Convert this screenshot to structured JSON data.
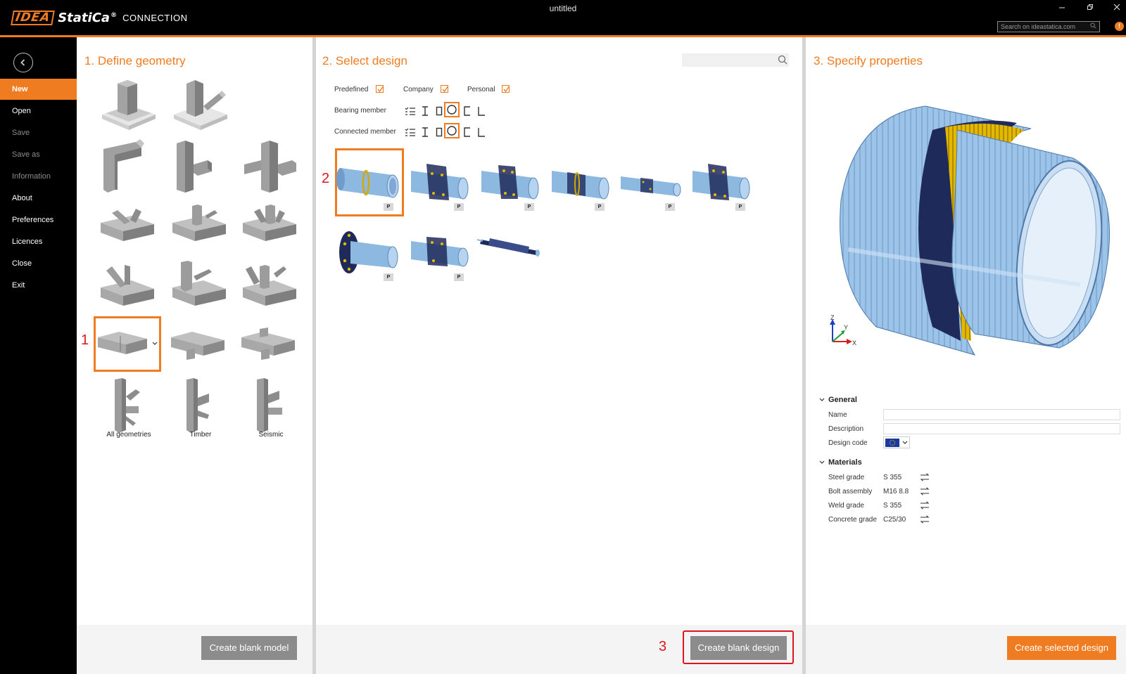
{
  "app": {
    "brand_idea": "IDEA",
    "brand_statica": "StatiCa",
    "brand_reg": "®",
    "product": "CONNECTION",
    "window_title": "untitled",
    "web_search_placeholder": "Search on ideastatica.com",
    "info_badge": "!"
  },
  "sidebar": {
    "items": [
      {
        "label": "New",
        "state": "active"
      },
      {
        "label": "Open",
        "state": "normal"
      },
      {
        "label": "Save",
        "state": "disabled"
      },
      {
        "label": "Save as",
        "state": "disabled"
      },
      {
        "label": "Information",
        "state": "disabled"
      },
      {
        "label": "About",
        "state": "normal"
      },
      {
        "label": "Preferences",
        "state": "normal"
      },
      {
        "label": "Licences",
        "state": "normal"
      },
      {
        "label": "Close",
        "state": "normal"
      },
      {
        "label": "Exit",
        "state": "normal"
      }
    ]
  },
  "geometry": {
    "title": "1. Define geometry",
    "captions": {
      "all": "All geometries",
      "timber": "Timber",
      "seismic": "Seismic"
    },
    "selected_tile": "splice-joint",
    "button": "Create blank model"
  },
  "design": {
    "title": "2. Select design",
    "filters": {
      "predefined": "Predefined",
      "company": "Company",
      "personal": "Personal"
    },
    "bearing_label": "Bearing member",
    "connected_label": "Connected member",
    "selected_profile": "circular-hollow",
    "badge": "P",
    "button": "Create blank design"
  },
  "properties": {
    "title": "3. Specify properties",
    "axes": {
      "z": "Z",
      "y": "Y",
      "x": "X"
    },
    "general_label": "General",
    "name_label": "Name",
    "name_value": "",
    "description_label": "Description",
    "description_value": "",
    "design_code_label": "Design code",
    "materials_label": "Materials",
    "steel_label": "Steel grade",
    "steel_value": "S 355",
    "bolt_label": "Bolt assembly",
    "bolt_value": "M16 8.8",
    "weld_label": "Weld grade",
    "weld_value": "S 355",
    "concrete_label": "Concrete grade",
    "concrete_value": "C25/30",
    "button": "Create selected design"
  },
  "annotations": {
    "one": "1",
    "two": "2",
    "three": "3"
  },
  "colors": {
    "accent": "#f07c22",
    "annotation": "#e0141e",
    "steel": "#9cc3e8",
    "weld": "#e5b800"
  }
}
